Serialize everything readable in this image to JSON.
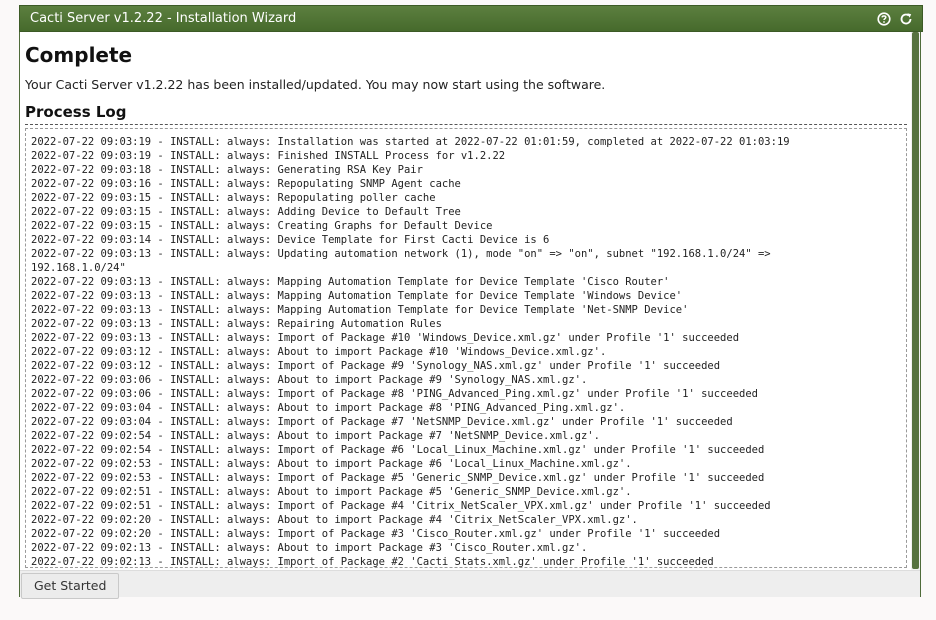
{
  "window": {
    "title": "Cacti Server v1.2.22 - Installation Wizard",
    "icons": [
      "help-icon",
      "refresh-icon"
    ]
  },
  "main": {
    "heading": "Complete",
    "intro": "Your Cacti Server v1.2.22 has been installed/updated. You may now start using the software.",
    "log_title": "Process Log",
    "log_lines": [
      "2022-07-22 09:03:19 - INSTALL: always: Installation was started at 2022-07-22 01:01:59, completed at 2022-07-22 01:03:19",
      "2022-07-22 09:03:19 - INSTALL: always: Finished INSTALL Process for v1.2.22",
      "2022-07-22 09:03:18 - INSTALL: always: Generating RSA Key Pair",
      "2022-07-22 09:03:16 - INSTALL: always: Repopulating SNMP Agent cache",
      "2022-07-22 09:03:15 - INSTALL: always: Repopulating poller cache",
      "2022-07-22 09:03:15 - INSTALL: always: Adding Device to Default Tree",
      "2022-07-22 09:03:15 - INSTALL: always: Creating Graphs for Default Device",
      "2022-07-22 09:03:14 - INSTALL: always: Device Template for First Cacti Device is 6",
      "2022-07-22 09:03:13 - INSTALL: always: Updating automation network (1), mode \"on\" => \"on\", subnet \"192.168.1.0/24\" =>\n192.168.1.0/24\"",
      "2022-07-22 09:03:13 - INSTALL: always: Mapping Automation Template for Device Template 'Cisco Router'",
      "2022-07-22 09:03:13 - INSTALL: always: Mapping Automation Template for Device Template 'Windows Device'",
      "2022-07-22 09:03:13 - INSTALL: always: Mapping Automation Template for Device Template 'Net-SNMP Device'",
      "2022-07-22 09:03:13 - INSTALL: always: Repairing Automation Rules",
      "2022-07-22 09:03:13 - INSTALL: always: Import of Package #10 'Windows_Device.xml.gz' under Profile '1' succeeded",
      "2022-07-22 09:03:12 - INSTALL: always: About to import Package #10 'Windows_Device.xml.gz'.",
      "2022-07-22 09:03:12 - INSTALL: always: Import of Package #9 'Synology_NAS.xml.gz' under Profile '1' succeeded",
      "2022-07-22 09:03:06 - INSTALL: always: About to import Package #9 'Synology_NAS.xml.gz'.",
      "2022-07-22 09:03:06 - INSTALL: always: Import of Package #8 'PING_Advanced_Ping.xml.gz' under Profile '1' succeeded",
      "2022-07-22 09:03:04 - INSTALL: always: About to import Package #8 'PING_Advanced_Ping.xml.gz'.",
      "2022-07-22 09:03:04 - INSTALL: always: Import of Package #7 'NetSNMP_Device.xml.gz' under Profile '1' succeeded",
      "2022-07-22 09:02:54 - INSTALL: always: About to import Package #7 'NetSNMP_Device.xml.gz'.",
      "2022-07-22 09:02:54 - INSTALL: always: Import of Package #6 'Local_Linux_Machine.xml.gz' under Profile '1' succeeded",
      "2022-07-22 09:02:53 - INSTALL: always: About to import Package #6 'Local_Linux_Machine.xml.gz'.",
      "2022-07-22 09:02:53 - INSTALL: always: Import of Package #5 'Generic_SNMP_Device.xml.gz' under Profile '1' succeeded",
      "2022-07-22 09:02:51 - INSTALL: always: About to import Package #5 'Generic_SNMP_Device.xml.gz'.",
      "2022-07-22 09:02:51 - INSTALL: always: Import of Package #4 'Citrix_NetScaler_VPX.xml.gz' under Profile '1' succeeded",
      "2022-07-22 09:02:20 - INSTALL: always: About to import Package #4 'Citrix_NetScaler_VPX.xml.gz'.",
      "2022-07-22 09:02:20 - INSTALL: always: Import of Package #3 'Cisco_Router.xml.gz' under Profile '1' succeeded",
      "2022-07-22 09:02:13 - INSTALL: always: About to import Package #3 'Cisco_Router.xml.gz'.",
      "2022-07-22 09:02:13 - INSTALL: always: Import of Package #2 'Cacti_Stats.xml.gz' under Profile '1' succeeded"
    ]
  },
  "footer": {
    "button_label": "Get Started"
  },
  "colors": {
    "titlebar": "#4f7534",
    "scrollbar_thumb": "#56723f",
    "page_bg": "#fbf9f9"
  }
}
